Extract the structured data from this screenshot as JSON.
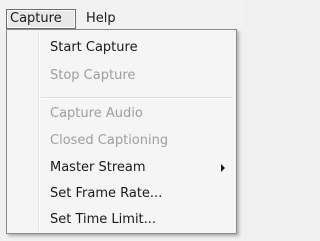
{
  "menubar": {
    "items": [
      {
        "label": "Capture"
      },
      {
        "label": "Help"
      }
    ]
  },
  "capture_menu": {
    "items": [
      {
        "label": "Start Capture",
        "enabled": true
      },
      {
        "label": "Stop Capture",
        "enabled": false
      },
      {
        "label": "Capture Audio",
        "enabled": false
      },
      {
        "label": "Closed Captioning",
        "enabled": false
      },
      {
        "label": "Master Stream",
        "enabled": true,
        "has_submenu": true
      },
      {
        "label": "Set Frame Rate...",
        "enabled": true
      },
      {
        "label": "Set Time Limit...",
        "enabled": true
      }
    ],
    "submenu_icon": "chevron-right-icon"
  }
}
